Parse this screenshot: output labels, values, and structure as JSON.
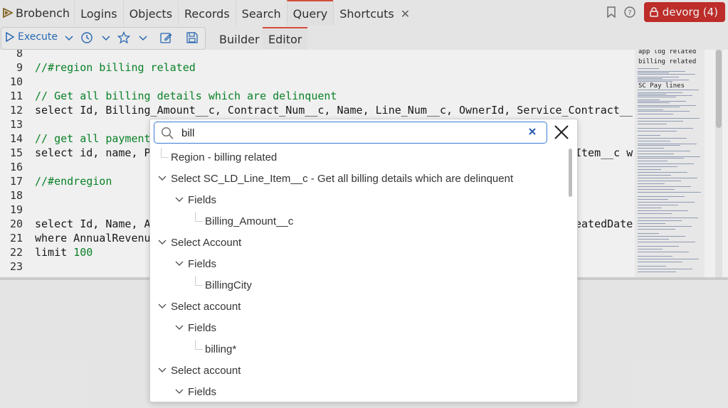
{
  "app": {
    "name": "Brobench",
    "org_badge": "devorg (4)",
    "colors": {
      "accent": "#e0533c",
      "org": "#c9302c",
      "link_blue": "#2a6ebb"
    }
  },
  "nav": {
    "tabs": [
      {
        "label": "Logins",
        "active": false
      },
      {
        "label": "Objects",
        "active": false
      },
      {
        "label": "Records",
        "active": false
      },
      {
        "label": "Search",
        "active": false
      },
      {
        "label": "Query",
        "active": true
      },
      {
        "label": "Shortcuts",
        "active": false,
        "closable": true
      }
    ]
  },
  "toolbar": {
    "execute_label": "Execute",
    "mode_tabs": [
      {
        "label": "Builder",
        "active": false
      },
      {
        "label": "Editor",
        "active": true
      }
    ]
  },
  "editor": {
    "lines": [
      {
        "n": "8",
        "text": ""
      },
      {
        "n": "9",
        "text": "//#region billing related",
        "kind": "comment"
      },
      {
        "n": "10",
        "text": ""
      },
      {
        "n": "11",
        "text": "// Get all billing details which are delinquent",
        "kind": "comment"
      },
      {
        "n": "12",
        "text": "select Id, Billing_Amount__c, Contract_Num__c, Name, Line_Num__c, OwnerId, Service_Contract__"
      },
      {
        "n": "13",
        "text": ""
      },
      {
        "n": "14",
        "text": "// get all payment",
        "kind": "comment"
      },
      {
        "n": "15",
        "text": "select id, name, P"
      },
      {
        "n": "16",
        "text": ""
      },
      {
        "n": "17",
        "text": "//#endregion",
        "kind": "comment"
      },
      {
        "n": "18",
        "text": ""
      },
      {
        "n": "19",
        "text": ""
      },
      {
        "n": "20",
        "text": "select Id, Name, A"
      },
      {
        "n": "21",
        "text": "where AnnualRevenu"
      },
      {
        "n": "22",
        "text": "limit 100",
        "kind": "limit"
      },
      {
        "n": "23",
        "text": ""
      }
    ],
    "right_fragments": [
      {
        "line": "15",
        "text": "Item__c w"
      },
      {
        "line": "20",
        "text": "eatedDate"
      }
    ],
    "minimap_labels": [
      "app log related",
      "billing related",
      "SC Pay lines"
    ]
  },
  "search": {
    "value": "bill",
    "results": [
      {
        "label": "Region - billing related",
        "depth": 0,
        "chevron": false
      },
      {
        "label": "Select SC_LD_Line_Item__c - Get all billing details which are delinquent",
        "depth": 0,
        "chevron": true
      },
      {
        "label": "Fields",
        "depth": 1,
        "chevron": true
      },
      {
        "label": "Billing_Amount__c",
        "depth": 2,
        "chevron": false
      },
      {
        "label": "Select Account",
        "depth": 0,
        "chevron": true
      },
      {
        "label": "Fields",
        "depth": 1,
        "chevron": true
      },
      {
        "label": "BillingCity",
        "depth": 2,
        "chevron": false
      },
      {
        "label": "Select account",
        "depth": 0,
        "chevron": true
      },
      {
        "label": "Fields",
        "depth": 1,
        "chevron": true
      },
      {
        "label": "billing*",
        "depth": 2,
        "chevron": false
      },
      {
        "label": "Select account",
        "depth": 0,
        "chevron": true
      },
      {
        "label": "Fields",
        "depth": 1,
        "chevron": true
      }
    ]
  }
}
